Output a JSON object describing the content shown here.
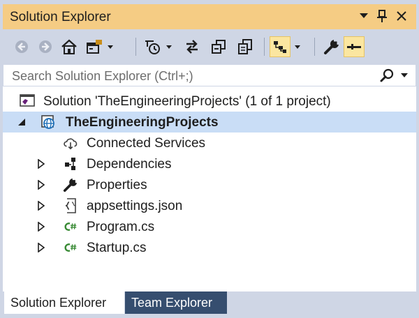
{
  "window": {
    "title": "Solution Explorer"
  },
  "toolbar": {
    "icons": [
      "back-icon",
      "forward-icon",
      "home-icon",
      "switch-views-icon",
      "pending-changes-icon",
      "sync-icon",
      "collapse-all-icon",
      "show-all-files-icon",
      "preview-selected-items-icon",
      "properties-icon",
      "pin-icon"
    ]
  },
  "search": {
    "placeholder": "Search Solution Explorer (Ctrl+;)",
    "value": ""
  },
  "tree": {
    "solution": "Solution 'TheEngineeringProjects' (1 of 1 project)",
    "project": "TheEngineeringProjects",
    "items": [
      {
        "label": "Connected Services",
        "icon": "connected-services-icon"
      },
      {
        "label": "Dependencies",
        "icon": "dependencies-icon"
      },
      {
        "label": "Properties",
        "icon": "wrench-icon"
      },
      {
        "label": "appsettings.json",
        "icon": "json-file-icon"
      },
      {
        "label": "Program.cs",
        "icon": "csharp-file-icon"
      },
      {
        "label": "Startup.cs",
        "icon": "csharp-file-icon"
      }
    ]
  },
  "tabs": [
    {
      "label": "Solution Explorer",
      "active": true
    },
    {
      "label": "Team Explorer",
      "active": false
    }
  ],
  "colors": {
    "titlebar": "#f5cc84",
    "panel": "#cfd6e5",
    "selected_row": "#c9ddf6",
    "active_tool": "#fbe6a0",
    "inactive_tab": "#364e6f",
    "csharp_green": "#388a34",
    "vs_purple": "#68217a"
  }
}
